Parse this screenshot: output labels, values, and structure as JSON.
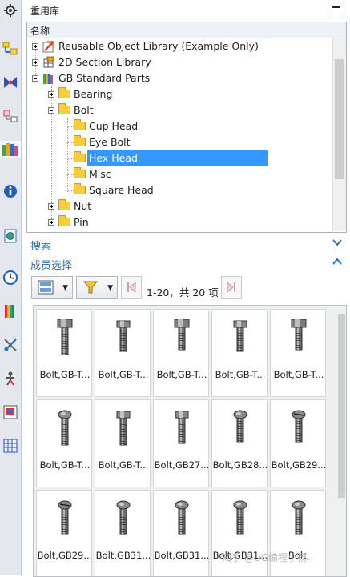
{
  "panel": {
    "title": "重用库"
  },
  "tree": {
    "column_header": "名称",
    "items": [
      {
        "label": "Reusable Object Library (Example Only)",
        "expander": "plus"
      },
      {
        "label": "2D Section Library",
        "expander": "plus"
      },
      {
        "label": "GB Standard Parts",
        "expander": "minus"
      },
      {
        "label": "Bearing",
        "expander": "plus"
      },
      {
        "label": "Bolt",
        "expander": "minus"
      },
      {
        "label": "Cup Head",
        "expander": ""
      },
      {
        "label": "Eye Bolt",
        "expander": ""
      },
      {
        "label": "Hex Head",
        "expander": "",
        "selected": true
      },
      {
        "label": "Misc",
        "expander": ""
      },
      {
        "label": "Square Head",
        "expander": ""
      },
      {
        "label": "Nut",
        "expander": "plus"
      },
      {
        "label": "Pin",
        "expander": "plus"
      }
    ]
  },
  "search": {
    "label": "搜索",
    "chevron": "chevron-down-icon"
  },
  "members": {
    "label": "成员选择",
    "chevron": "chevron-up-icon"
  },
  "toolbar": {
    "page_info": "1-20，共 20 项"
  },
  "parts": [
    {
      "caption": "Bolt,GB-T..."
    },
    {
      "caption": "Bolt,GB-T..."
    },
    {
      "caption": "Bolt,GB-T..."
    },
    {
      "caption": "Bolt,GB-T..."
    },
    {
      "caption": "Bolt,GB-T..."
    },
    {
      "caption": "Bolt,GB-T..."
    },
    {
      "caption": "Bolt,GB-T..."
    },
    {
      "caption": "Bolt,GB27..."
    },
    {
      "caption": "Bolt,GB28..."
    },
    {
      "caption": "Bolt,GB29..."
    },
    {
      "caption": "Bolt,GB29..."
    },
    {
      "caption": "Bolt,GB31..."
    },
    {
      "caption": "Bolt,GB31..."
    },
    {
      "caption": "Bolt,GB31..."
    },
    {
      "caption": "Bolt,"
    }
  ],
  "watermark": "知乎 @UG编程小杨",
  "colors": {
    "accent_blue": "#2a6fb3",
    "selection": "#3399ff",
    "folder": "#f3cf3b"
  }
}
